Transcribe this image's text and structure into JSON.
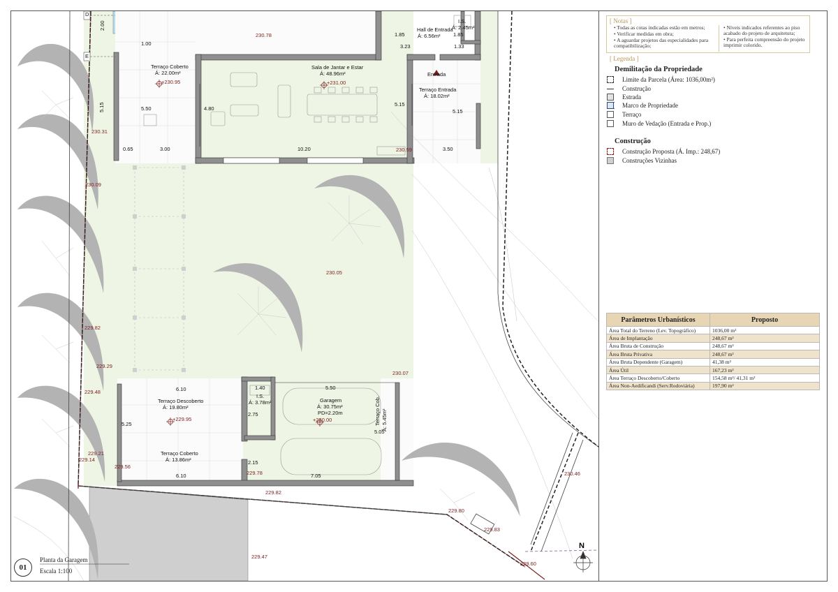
{
  "notes": {
    "title": "[ Notas ]",
    "left": [
      "• Todas as cotas indicadas estão em metros;",
      "• Verificar medidas em obra;",
      "• A aguardar  projetos das especialidades para compatibilização;"
    ],
    "right": [
      "• Níveis indicados referentes ao piso acabado do projeto de arquitetura;",
      "• Para perfeita compreensão do projeto imprimir colorido."
    ]
  },
  "legend": {
    "title": "[ Legenda ]",
    "section1_title": "Demilitação da Propriedade",
    "section1_items": [
      "Limite da Parcela (Área: 1036,00m²)",
      "Construção",
      "Estrada",
      "Marco de Propriedade",
      "Terraço",
      "Muro de Vedação (Entrada e Prop.)"
    ],
    "section2_title": "Construção",
    "section2_items": [
      "Construção Proposta (Á. Imp.: 248,67)",
      "Construções Vizinhas"
    ]
  },
  "params": {
    "header": [
      "Parâmetros Urbanísticos",
      "Proposto"
    ],
    "rows": [
      [
        "Área Total do Terreno (Lev. Topográfico)",
        "1036,00 m²"
      ],
      [
        "Área de Implantação",
        "248,67 m²"
      ],
      [
        "Área Bruta de Construção",
        "248,67 m²"
      ],
      [
        "Área Bruta Privativa",
        "248,67 m²"
      ],
      [
        "Área Bruta Dependente (Garagem)",
        "41,38 m²"
      ],
      [
        "Área Útil",
        "167,23 m²"
      ],
      [
        "Área Terraço Descoberto/Coberto",
        "154,58 m²/ 41,31 m²"
      ],
      [
        "Área Non-Aedificandi (Serv.Rodoviária)",
        "197,90 m²"
      ]
    ]
  },
  "sheet": {
    "number": "01",
    "title": "Planta da Garagem",
    "scale": "Escala 1:100",
    "north": "N"
  },
  "rooms": {
    "terraco_coberto_top": [
      "Terraço Coberto",
      "Á: 22.00m²"
    ],
    "sala": [
      "Sala de Jantar e Estar",
      "Á: 48.96m²"
    ],
    "hall": [
      "Hall de Entrada",
      "Á: 6.56m²"
    ],
    "is_top": [
      "I.S.",
      "Á: 2.45m²"
    ],
    "entrada": "Entrada",
    "terraco_entrada": [
      "Terraço Entrada",
      "Á: 18.02m²"
    ],
    "terraco_descoberto": [
      "Terraço Descoberto",
      "Á: 19.80m²"
    ],
    "is_bottom": [
      "I.S.",
      "Á: 3.78m²"
    ],
    "garagem": [
      "Garagem",
      "Á: 30.75m²",
      "PD=2.20m"
    ],
    "terraco_coberto_bottom": [
      "Terraço Coberto",
      "Á: 13.86m²"
    ],
    "terraco_cob": [
      "Terraço Cob.",
      "Á: 5.45m²"
    ]
  },
  "levels": {
    "l1": "230.78",
    "l2": "+230.95",
    "l3": "+231.00",
    "l4": "230.31",
    "l5": "230.59",
    "l6": "230.09",
    "l7": "230.05",
    "l8": "229.82",
    "l9": "229.29",
    "l10": "229.48",
    "l11": "230.07",
    "l12": "+229.95",
    "l13": "+230.00",
    "l14": "229.21",
    "l15": "229.14",
    "l16": "229.56",
    "l17": "229.78",
    "l18": "229.82",
    "l19": "229.80",
    "l20": "229.83",
    "l21": "230.46",
    "l22": "229.47",
    "l23": "229.60"
  },
  "dims": {
    "d1": "2.00",
    "d2": "1.00",
    "d3": "5.15",
    "d4": "5.50",
    "d5": "4.80",
    "d6": "0.65",
    "d7": "3.00",
    "d8": "10.20",
    "d9": "1.85",
    "d10": "1.85",
    "d11": "3.23",
    "d12": "1.33",
    "d13": "5.15",
    "d14": "5.15",
    "d15": "3.50",
    "d16": "6.10",
    "d17": "1.40",
    "d18": "5.50",
    "d19": "5.25",
    "d20": "2.75",
    "d21": "5.05",
    "d22": "2.15",
    "d23": "6.10",
    "d24": "7.05"
  },
  "grid_marks": {
    "g1": "D",
    "g2": "E"
  }
}
